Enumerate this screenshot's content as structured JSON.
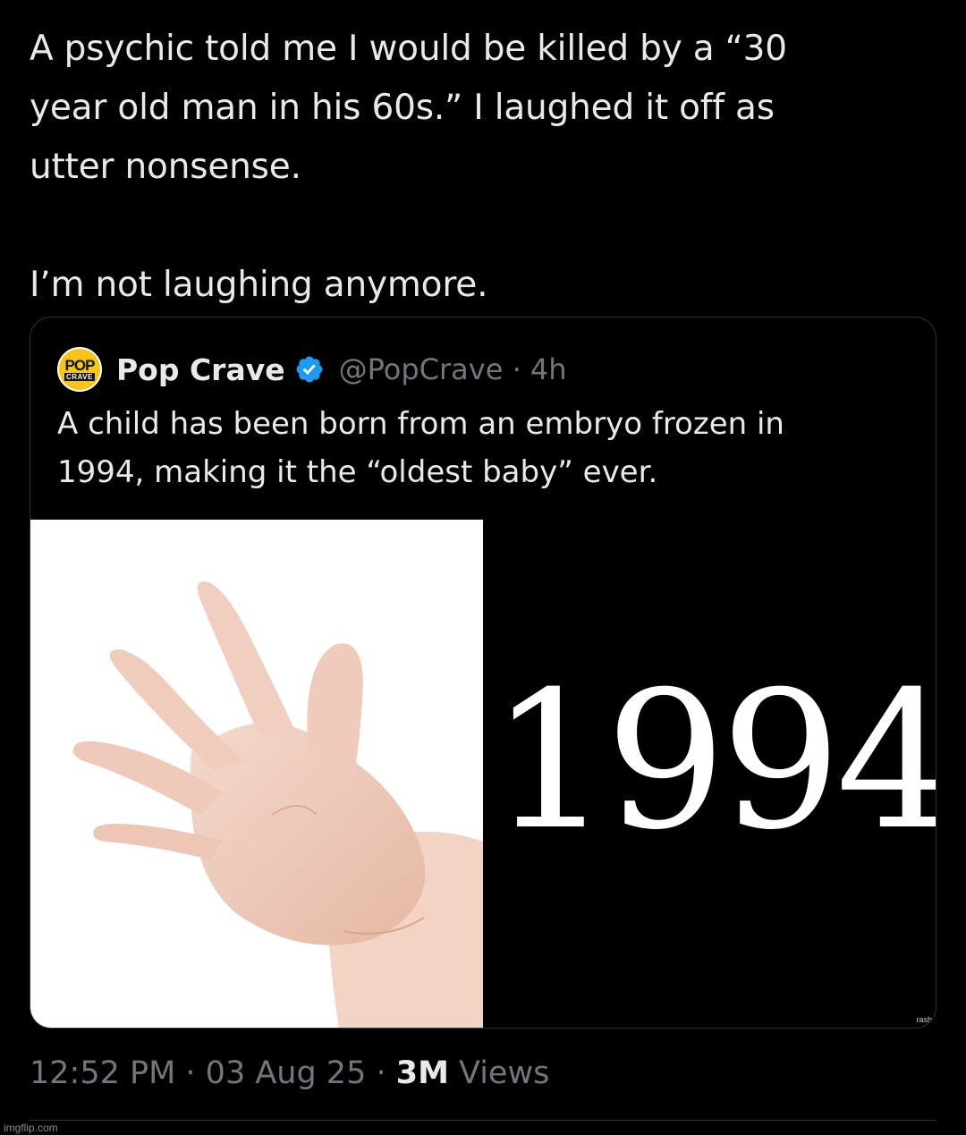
{
  "tweet": {
    "line1": "A psychic told me I would be killed by a “30",
    "line2": "year old man in his 60s.” I laughed it off as",
    "line3": "utter nonsense.",
    "line4": "I’m not laughing anymore."
  },
  "quote": {
    "avatar": {
      "top": "POP",
      "bottom": "CRAVE"
    },
    "author_name": "Pop Crave",
    "verified_icon": "verified-badge-icon",
    "handle_time": "@PopCrave · 4h",
    "text_line1": "A child has been born from an embryo frozen in",
    "text_line2": "1994, making it the “oldest baby” ever.",
    "media": {
      "year": "1994",
      "watermark": "rash"
    }
  },
  "meta": {
    "time_date": "12:52 PM · 03 Aug 25 · ",
    "views_count": "3M",
    "views_label": " Views"
  },
  "footer": {
    "watermark": "imgflip.com"
  },
  "colors": {
    "background": "#000000",
    "text": "#e7e9ea",
    "muted": "#71767b",
    "verified": "#1d9bf0",
    "border": "#2f3336"
  }
}
